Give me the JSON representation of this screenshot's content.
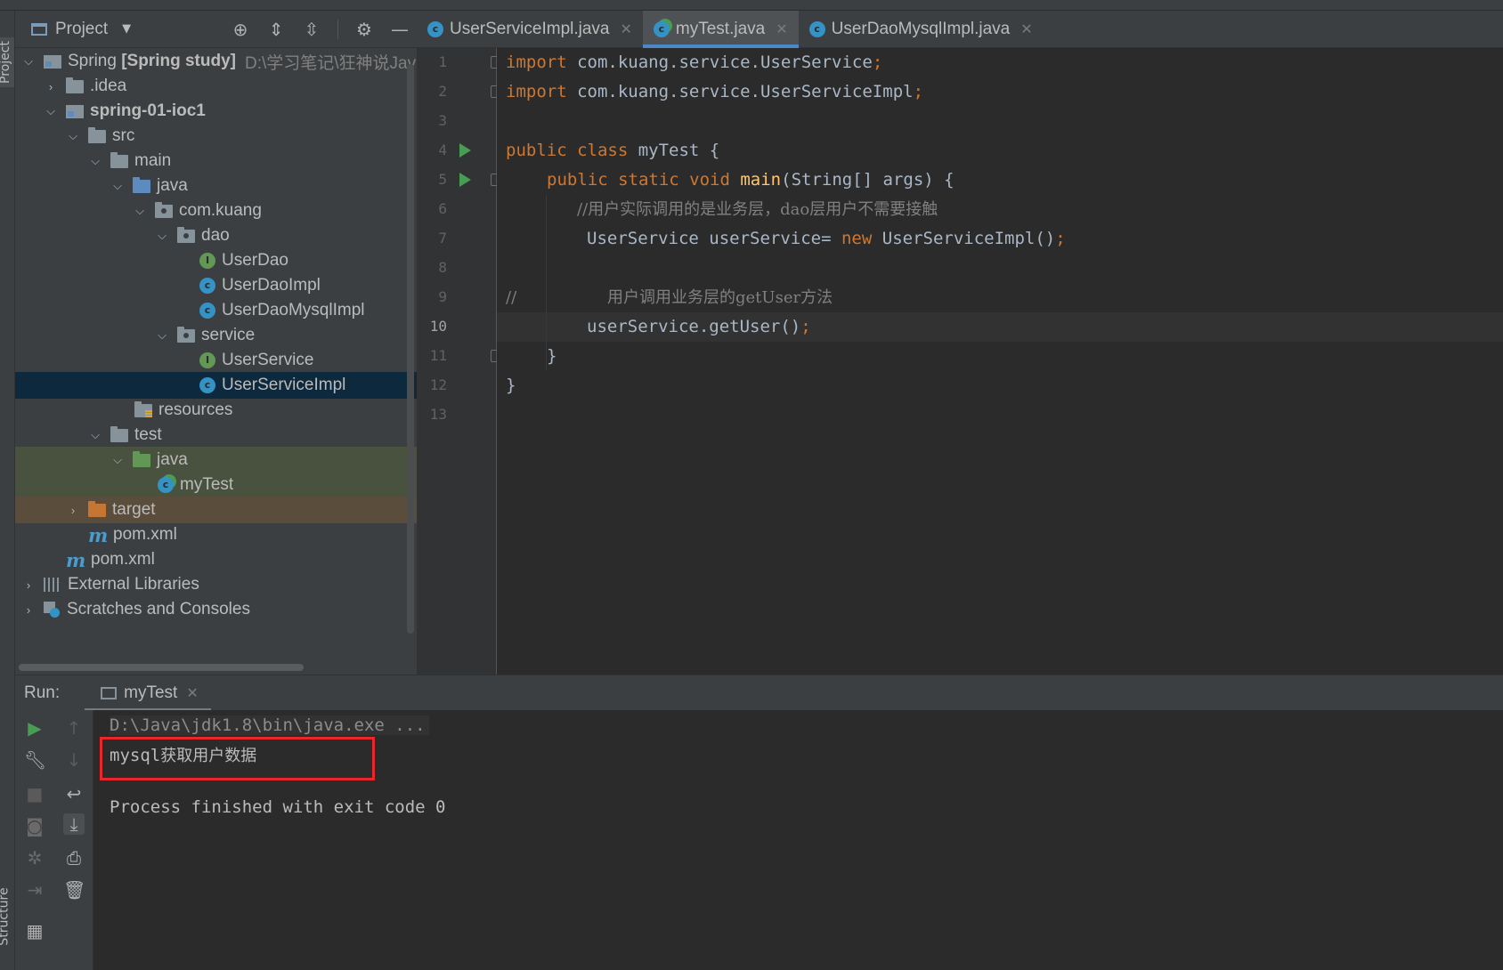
{
  "project_panel": {
    "title": "Project",
    "tree": [
      {
        "label": "Spring",
        "bold_suffix": "[Spring study]",
        "hint": "D:\\学习笔记\\狂神说Jav",
        "icon": "module-icon",
        "chevron": "down"
      },
      {
        "label": ".idea",
        "icon": "folder-icon",
        "chevron": "right"
      },
      {
        "label": "spring-01-ioc1",
        "icon": "module-icon",
        "chevron": "down",
        "bold": true
      },
      {
        "label": "src",
        "icon": "folder-icon",
        "chevron": "down"
      },
      {
        "label": "main",
        "icon": "folder-icon",
        "chevron": "down"
      },
      {
        "label": "java",
        "icon": "source-folder-icon",
        "chevron": "down"
      },
      {
        "label": "com.kuang",
        "icon": "package-icon",
        "chevron": "down"
      },
      {
        "label": "dao",
        "icon": "package-icon",
        "chevron": "down"
      },
      {
        "label": "UserDao",
        "icon": "interface-icon"
      },
      {
        "label": "UserDaoImpl",
        "icon": "class-icon"
      },
      {
        "label": "UserDaoMysqlImpl",
        "icon": "class-icon"
      },
      {
        "label": "service",
        "icon": "package-icon",
        "chevron": "down"
      },
      {
        "label": "UserService",
        "icon": "interface-icon"
      },
      {
        "label": "UserServiceImpl",
        "icon": "class-icon",
        "selected": true
      },
      {
        "label": "resources",
        "icon": "resources-folder-icon"
      },
      {
        "label": "test",
        "icon": "folder-icon",
        "chevron": "down"
      },
      {
        "label": "java",
        "icon": "test-folder-icon",
        "chevron": "down"
      },
      {
        "label": "myTest",
        "icon": "runnable-class-icon"
      },
      {
        "label": "target",
        "icon": "excluded-folder-icon",
        "chevron": "right"
      },
      {
        "label": "pom.xml",
        "icon": "maven-icon"
      },
      {
        "label": "pom.xml",
        "icon": "maven-icon"
      },
      {
        "label": "External Libraries",
        "icon": "library-icon",
        "chevron": "right"
      },
      {
        "label": "Scratches and Consoles",
        "icon": "scratches-icon",
        "chevron": "right"
      }
    ]
  },
  "stripe": {
    "project": "Project",
    "structure": "Structure"
  },
  "tabs": [
    {
      "label": "UserServiceImpl.java",
      "icon": "class-icon",
      "active": false
    },
    {
      "label": "myTest.java",
      "icon": "runnable-class-icon",
      "active": true
    },
    {
      "label": "UserDaoMysqlImpl.java",
      "icon": "class-icon",
      "active": false
    }
  ],
  "editor": {
    "line_numbers": [
      "1",
      "2",
      "3",
      "4",
      "5",
      "6",
      "7",
      "8",
      "9",
      "10",
      "11",
      "12",
      "13"
    ],
    "current_line": "10",
    "code": {
      "l1_kw": "import",
      "l1_rest": " com.kuang.service.UserService",
      "l1_semi": ";",
      "l2_kw": "import",
      "l2_rest": " com.kuang.service.UserServiceImpl",
      "l2_semi": ";",
      "l4_kw": "public class",
      "l4_rest": " myTest {",
      "l5_kw": "public static void",
      "l5_fn": "main",
      "l5_rest": "(String[] args) {",
      "l6_cm": "//用户实际调用的是业务层，dao层用户不需要接触",
      "l7_rest": "UserService userService= ",
      "l7_kw": "new",
      "l7_rest2": " UserServiceImpl()",
      "l7_semi": ";",
      "l9_slash": "//",
      "l9_cm": "用户调用业务层的getUser方法",
      "l10_rest": "userService.getUser()",
      "l10_semi": ";",
      "l11": "}",
      "l12": "}"
    }
  },
  "run": {
    "label": "Run:",
    "tab": "myTest",
    "console": {
      "cmd": "D:\\Java\\jdk1.8\\bin\\java.exe ...",
      "out_prefix": "mysql",
      "out_cn": "获取用户数据",
      "exit": "Process finished with exit code 0"
    }
  },
  "colors": {
    "highlight_box": "#e8262b",
    "keyword": "#cc7832",
    "function": "#ffc66d",
    "comment": "#808080"
  }
}
